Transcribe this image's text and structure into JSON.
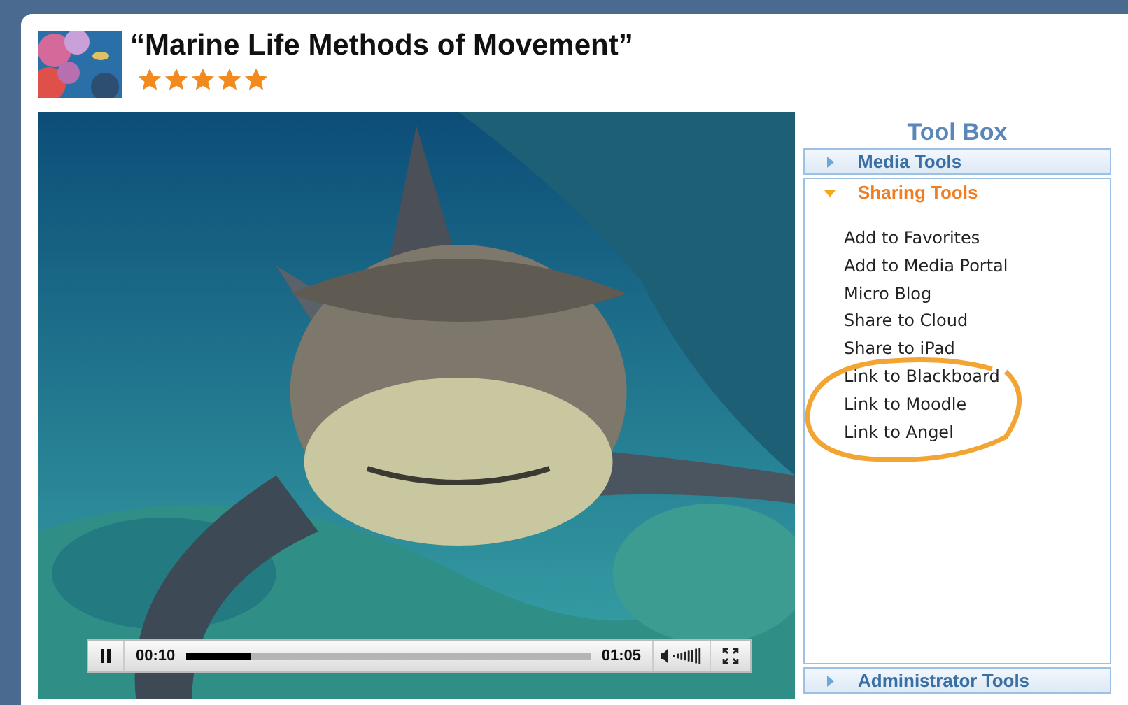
{
  "header": {
    "title": "“Marine Life Methods of Movement”",
    "stars": 5
  },
  "video": {
    "player": {
      "playing": true,
      "elapsed": "00:10",
      "level": 0.16,
      "duration": "01:05"
    }
  },
  "toolbox": {
    "title": "Tool Box",
    "sections": [
      {
        "label": "Media Tools",
        "expanded": false
      },
      {
        "label": "Sharing Tools",
        "expanded": true,
        "items": [
          "Add to Favorites",
          "Add to Media Portal",
          "Micro Blog",
          "Share to Cloud",
          "Share to iPad",
          "Link to Blackboard",
          "Link to Moodle",
          "Link to Angel"
        ]
      },
      {
        "label": "Administrator Tools",
        "expanded": false
      }
    ]
  }
}
